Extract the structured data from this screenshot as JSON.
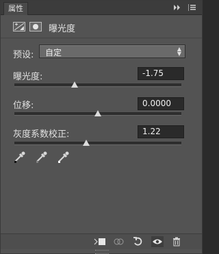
{
  "panel": {
    "tab_label": "属性",
    "adjustment_title": "曝光度"
  },
  "preset": {
    "label": "预设:",
    "value": "自定"
  },
  "params": [
    {
      "label": "曝光度:",
      "value": "-1.75",
      "slider_fraction": 0.36
    },
    {
      "label": "位移:",
      "value": "0.0000",
      "slider_fraction": 0.5
    },
    {
      "label": "灰度系数校正:",
      "value": "1.22",
      "slider_fraction": 0.43
    }
  ],
  "icons": {
    "collapse": "double-chevron-right-icon",
    "menu": "panel-menu-icon",
    "adjustment": "exposure-adjustment-icon",
    "mask": "layer-mask-icon",
    "eyedroppers": [
      "black-eyedropper-icon",
      "gray-eyedropper-icon",
      "white-eyedropper-icon"
    ],
    "footer": [
      "clip-to-layer-icon",
      "view-previous-state-icon",
      "reset-icon",
      "visibility-eye-icon",
      "trash-icon"
    ]
  },
  "colors": {
    "panel_bg": "#535353",
    "field_bg": "#2a2a2a",
    "select_bg": "#6a6a6a"
  }
}
